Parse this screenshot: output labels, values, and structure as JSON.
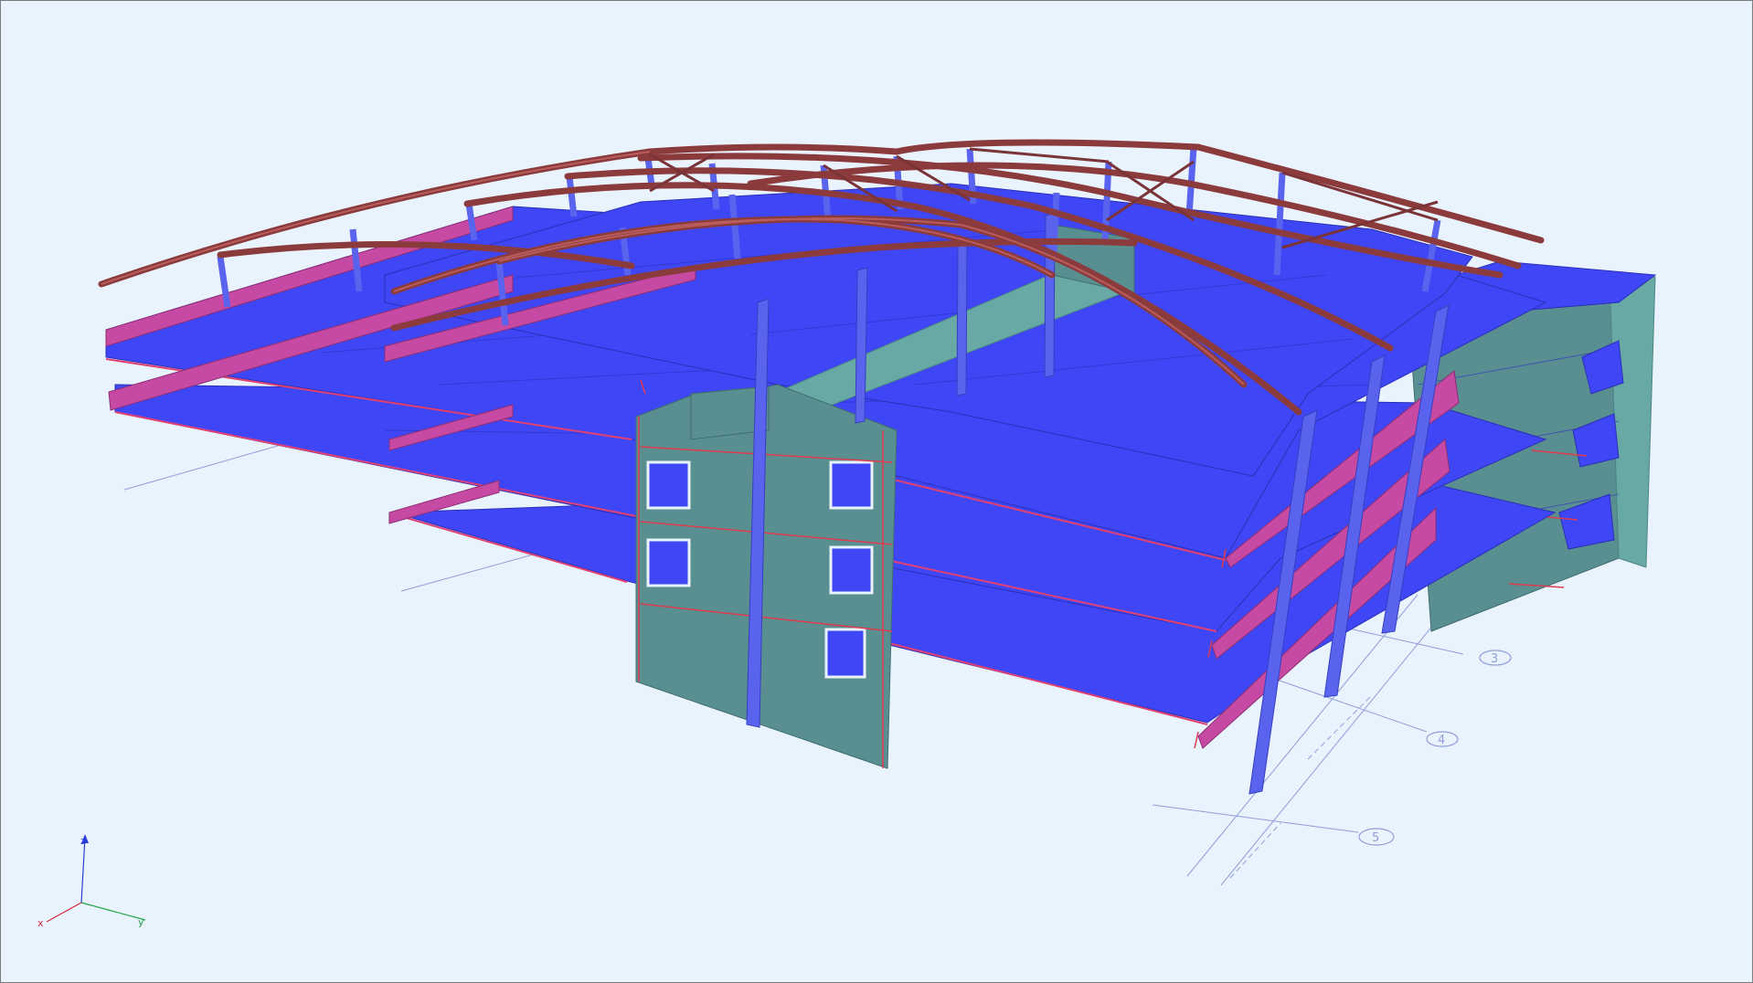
{
  "viewport": {
    "background": "#e9f3fd",
    "colors": {
      "slab": "#3f46f5",
      "wall": "#5a8f91",
      "column": "#5a63ee",
      "steel_beam": "#c64aa3",
      "truss": "#8c3b3d",
      "grid": "#8f9fd6"
    }
  },
  "grid_axes": [
    {
      "label": "3"
    },
    {
      "label": "4"
    },
    {
      "label": "5"
    }
  ],
  "coordinate_axes": {
    "x": "x",
    "y": "y",
    "z": "z"
  }
}
